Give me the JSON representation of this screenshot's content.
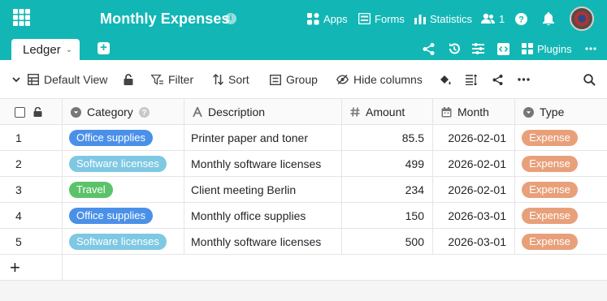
{
  "header": {
    "title": "Monthly Expenses",
    "nav": [
      {
        "label": "Apps",
        "icon": "apps-icon"
      },
      {
        "label": "Forms",
        "icon": "forms-icon"
      },
      {
        "label": "Statistics",
        "icon": "statistics-icon"
      }
    ],
    "collaborators_count": "1",
    "brand_color": "#12b7b5"
  },
  "tabs": {
    "active_label": "Ledger",
    "plugins_label": "Plugins"
  },
  "toolbar": {
    "view_label": "Default View",
    "filter_label": "Filter",
    "sort_label": "Sort",
    "group_label": "Group",
    "hide_columns_label": "Hide columns"
  },
  "table": {
    "columns": [
      {
        "label": "Category",
        "icon": "single-select-icon"
      },
      {
        "label": "Description",
        "icon": "text-icon"
      },
      {
        "label": "Amount",
        "icon": "number-icon"
      },
      {
        "label": "Month",
        "icon": "date-icon"
      },
      {
        "label": "Type",
        "icon": "single-select-icon"
      }
    ],
    "rows": [
      {
        "num": "1",
        "category": "Office supplies",
        "category_color": "#4a90e8",
        "description": "Printer paper and toner",
        "amount": "85.5",
        "month": "2026-02-01",
        "type": "Expense"
      },
      {
        "num": "2",
        "category": "Software licenses",
        "category_color": "#7ec8e3",
        "description": "Monthly software licenses",
        "amount": "499",
        "month": "2026-02-01",
        "type": "Expense"
      },
      {
        "num": "3",
        "category": "Travel",
        "category_color": "#5cc26a",
        "description": "Client meeting Berlin",
        "amount": "234",
        "month": "2026-02-01",
        "type": "Expense"
      },
      {
        "num": "4",
        "category": "Office supplies",
        "category_color": "#4a90e8",
        "description": "Monthly office supplies",
        "amount": "150",
        "month": "2026-03-01",
        "type": "Expense"
      },
      {
        "num": "5",
        "category": "Software licenses",
        "category_color": "#7ec8e3",
        "description": "Monthly software licenses",
        "amount": "500",
        "month": "2026-03-01",
        "type": "Expense"
      }
    ],
    "type_color": "#e8a07a",
    "add_row_label": "+"
  }
}
